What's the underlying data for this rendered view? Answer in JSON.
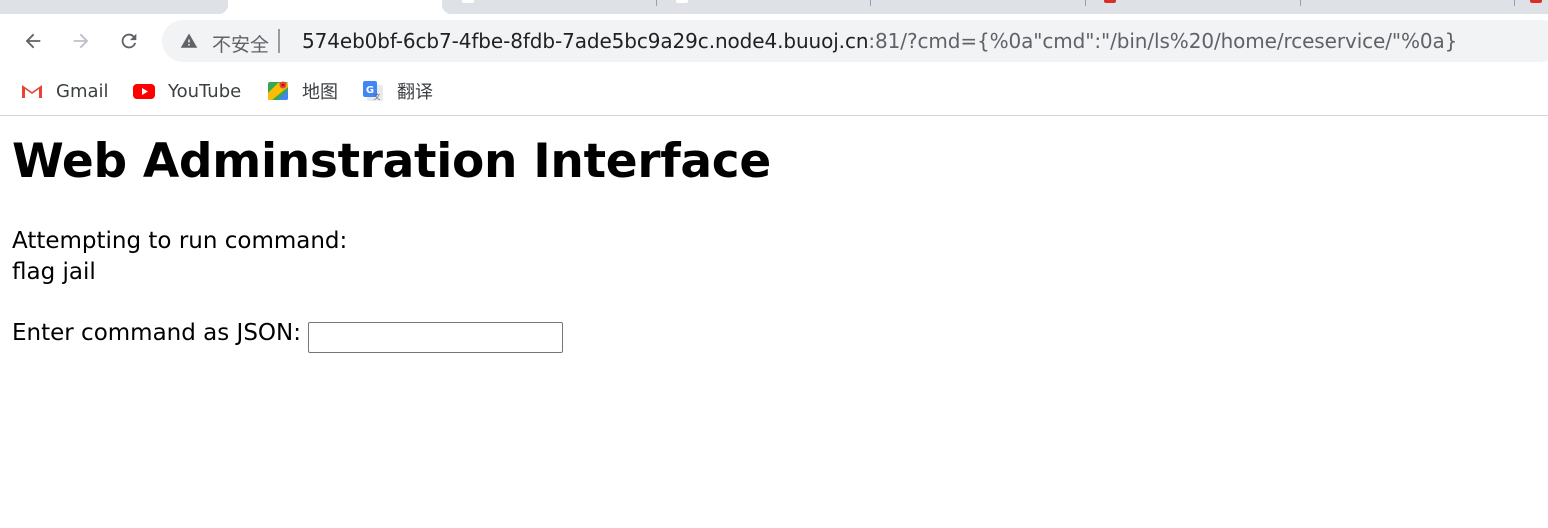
{
  "browser": {
    "tabs": [
      {
        "state": "inactive"
      },
      {
        "state": "active"
      },
      {
        "state": "inactive"
      },
      {
        "state": "inactive"
      },
      {
        "state": "inactive"
      },
      {
        "state": "inactive"
      }
    ],
    "toolbar": {
      "back_icon": "arrow-left-icon",
      "forward_icon": "arrow-right-icon",
      "reload_icon": "reload-icon"
    },
    "omnibox": {
      "security_icon": "warning-triangle-icon",
      "security_text": "不安全",
      "url_host": "574eb0bf-6cb7-4fbe-8fdb-7ade5bc9a29c.node4.buuoj.cn",
      "url_rest": ":81/?cmd={%0a\"cmd\":\"/bin/ls%20/home/rceservice/\"%0a}"
    },
    "bookmarks": [
      {
        "label": "Gmail",
        "icon": "gmail-icon"
      },
      {
        "label": "YouTube",
        "icon": "youtube-icon"
      },
      {
        "label": "地图",
        "icon": "maps-icon"
      },
      {
        "label": "翻译",
        "icon": "translate-icon"
      }
    ]
  },
  "page": {
    "title": "Web Adminstration Interface",
    "status_text": "Attempting to run command:",
    "output_text": "flag jail",
    "prompt_label": "Enter command as JSON:",
    "command_input_value": ""
  },
  "colors": {
    "tabstrip": "#dee1e6",
    "omnibox_bg": "#f1f3f4",
    "url_secondary": "#5f6368",
    "gmail_red": "#ea4335",
    "youtube_red": "#ff0000"
  }
}
